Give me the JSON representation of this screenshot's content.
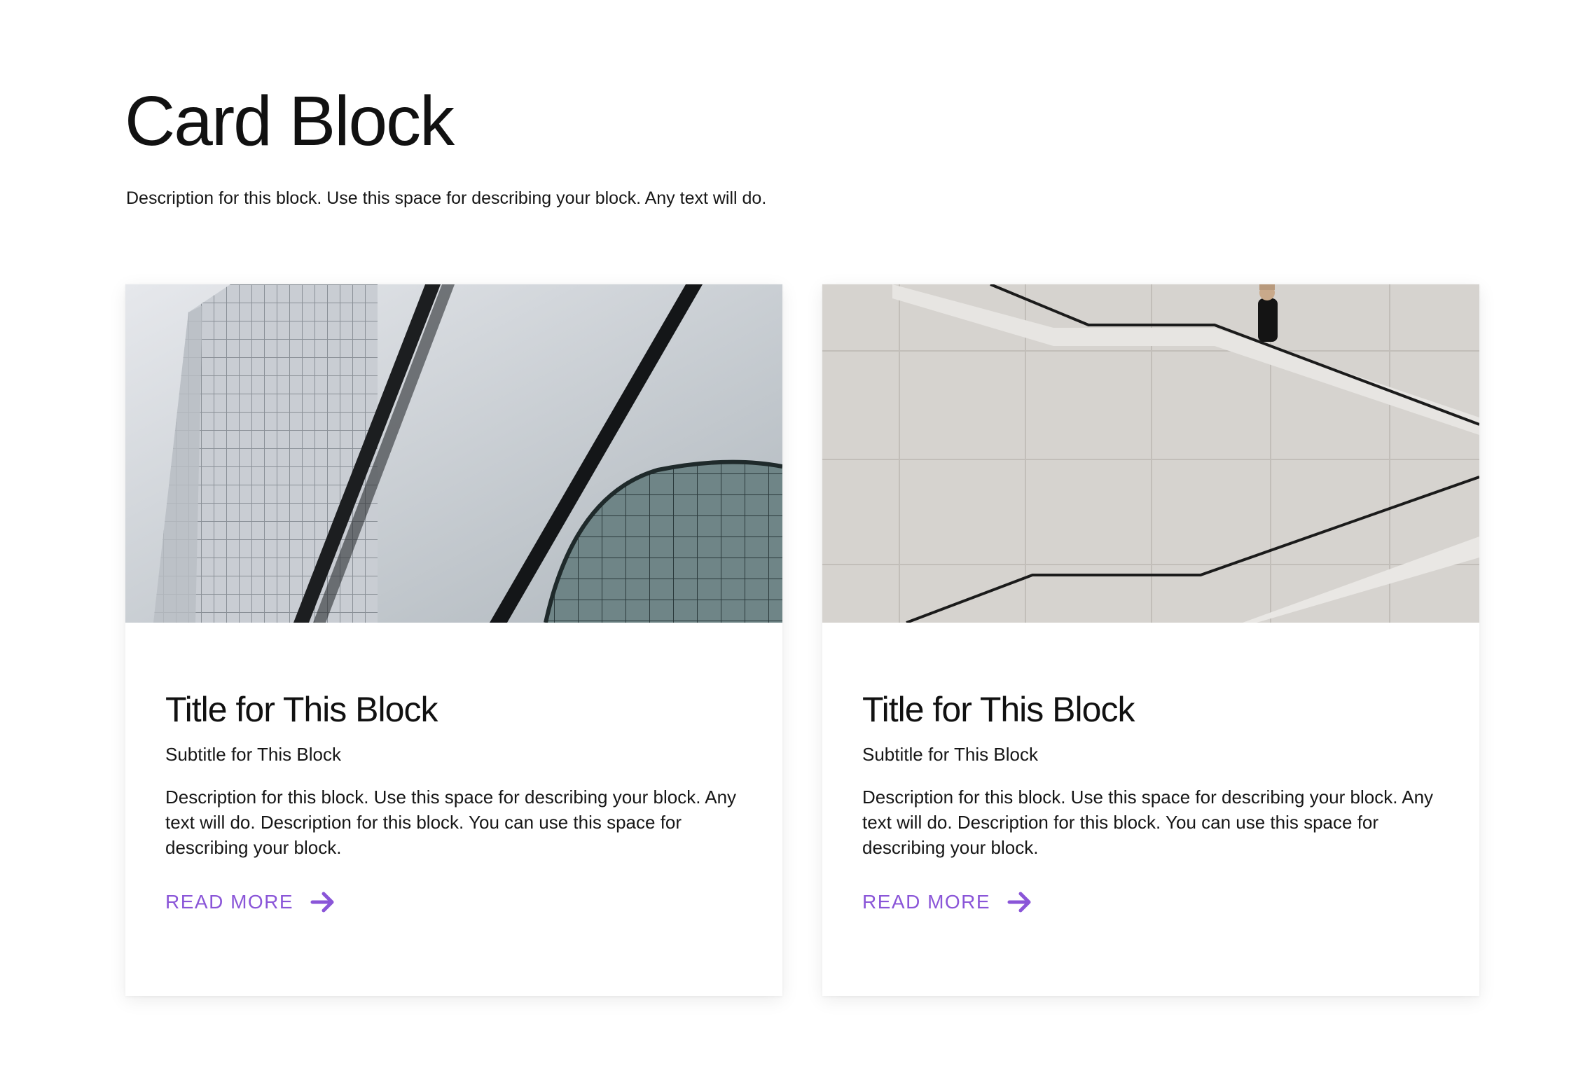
{
  "header": {
    "title": "Card Block",
    "description": "Description for this block. Use this space for describing your block. Any text will do."
  },
  "cards": [
    {
      "image_icon": "architecture-photo",
      "title": "Title for This Block",
      "subtitle": "Subtitle for This Block",
      "description": "Description for this block. Use this space for describing your block. Any text will do. Description for this block. You can use this space for describing your block.",
      "link_label": "READ MORE",
      "link_icon": "arrow-right-icon"
    },
    {
      "image_icon": "staircase-photo",
      "title": "Title for This Block",
      "subtitle": "Subtitle for This Block",
      "description": "Description for this block. Use this space for describing your block. Any text will do. Description for this block. You can use this space for describing your block.",
      "link_label": "READ MORE",
      "link_icon": "arrow-right-icon"
    }
  ],
  "colors": {
    "accent": "#8a55d8",
    "text": "#161616",
    "background": "#ffffff"
  }
}
